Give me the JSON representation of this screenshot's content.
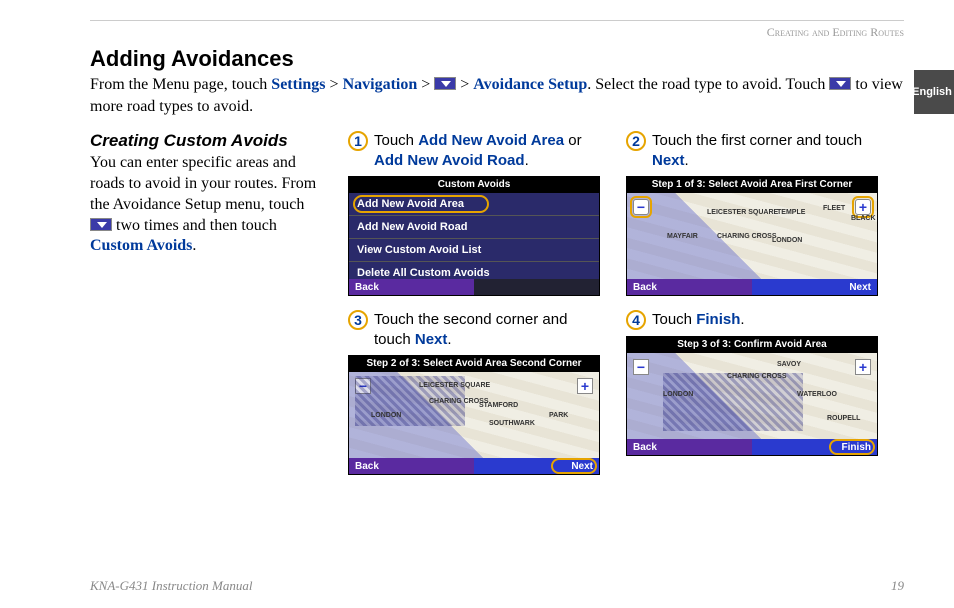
{
  "header": {
    "breadcrumb": "Creating and Editing Routes",
    "language_tab": "English"
  },
  "title": "Adding Avoidances",
  "intro": {
    "t1": "From the Menu page, touch ",
    "l1": "Settings",
    "sep1": " > ",
    "l2": "Navigation",
    "sep2": " > ",
    "sep3": " > ",
    "l3": "Avoidance Setup",
    "t2": ". Select the road type to avoid. Touch ",
    "t3": " to view more road types to avoid."
  },
  "left": {
    "heading": "Creating Custom Avoids",
    "p1": "You can enter specific areas and roads to avoid in your routes. From the Avoidance Setup menu, touch ",
    "p2": " two times and then touch ",
    "link": "Custom Avoids",
    "p3": "."
  },
  "steps": {
    "s1": {
      "num": "1",
      "a": "Touch ",
      "b": "Add New Avoid Area",
      "c": " or ",
      "d": "Add New Avoid Road",
      "e": "."
    },
    "s2": {
      "num": "2",
      "a": "Touch the first corner and touch ",
      "b": "Next",
      "c": "."
    },
    "s3": {
      "num": "3",
      "a": "Touch the second corner and touch ",
      "b": "Next",
      "c": "."
    },
    "s4": {
      "num": "4",
      "a": "Touch ",
      "b": "Finish",
      "c": "."
    }
  },
  "screens": {
    "menu": {
      "title": "Custom Avoids",
      "items": [
        "Add New Avoid Area",
        "Add New Avoid Road",
        "View Custom Avoid List",
        "Delete All Custom Avoids"
      ],
      "back": "Back"
    },
    "map1": {
      "title": "Step 1 of 3: Select Avoid Area First Corner",
      "back": "Back",
      "next": "Next",
      "labels": [
        "LEICESTER SQUARE",
        "MAYFAIR",
        "CHARING CROSS",
        "LONDON",
        "TEMPLE",
        "FLEET",
        "BLACK"
      ]
    },
    "map2": {
      "title": "Step 2 of 3: Select Avoid Area Second Corner",
      "back": "Back",
      "next": "Next",
      "labels": [
        "LEICESTER SQUARE",
        "LONDON",
        "CHARING CROSS",
        "SOUTHWARK",
        "STAMFORD",
        "PARK"
      ]
    },
    "map3": {
      "title": "Step 3 of 3: Confirm Avoid Area",
      "back": "Back",
      "finish": "Finish",
      "labels": [
        "SAVOY",
        "CHARING CROSS",
        "LONDON",
        "WATERLOO",
        "ROUPELL"
      ]
    }
  },
  "footer": {
    "left": "KNA-G431 Instruction Manual",
    "right": "19"
  }
}
